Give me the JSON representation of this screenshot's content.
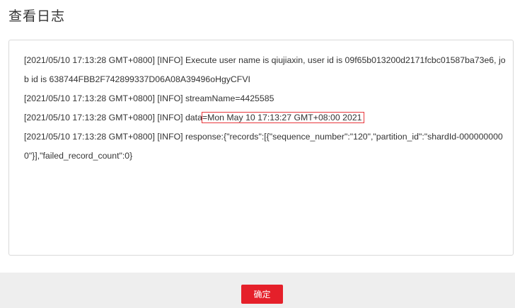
{
  "dialog": {
    "title": "查看日志",
    "confirm_label": "确定"
  },
  "log": {
    "line1a": "[2021/05/10 17:13:28 GMT+0800] [INFO] Execute user name is qiujiaxin, user id is 09f65b013200d2171fcbc01587ba73e6, jo",
    "line1b": "b id is 638744FBB2F742899337D06A08A39496oHgyCFVI",
    "line2": "[2021/05/10 17:13:28 GMT+0800] [INFO] streamName=4425585",
    "line3_prefix": "[2021/05/10 17:13:28 GMT+0800] [INFO] data",
    "line3_highlight": "=Mon May 10 17:13:27 GMT+08:00 2021",
    "line4a": "[2021/05/10 17:13:28 GMT+0800] [INFO] response:{\"records\":[{\"sequence_number\":\"120\",\"partition_id\":\"shardId-000000000",
    "line4b": "0\"}],\"failed_record_count\":0}"
  },
  "colors": {
    "accent": "#e5202a",
    "highlight_border": "#e8373c",
    "footer_bg": "#eeeeee"
  }
}
